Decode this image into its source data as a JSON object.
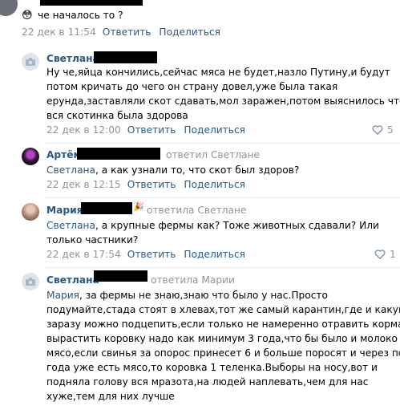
{
  "comment0": {
    "emoji": "😳",
    "text": "че началось то ?",
    "date": "22 дек в 11:54",
    "reply": "Ответить",
    "share": "Поделиться"
  },
  "comments": [
    {
      "author": "Светлана",
      "lines": [
        "Ну че,яйца кончились,сейчас мяса не будет,назло Путину,и будут",
        "потом кричать до чего он страну довел,уже была такая",
        "ерунда,заставляли скот сдавать,мол заражен,потом выяснилось что",
        "вся скотинка была здорова"
      ],
      "date": "22 дек в 12:00",
      "reply": "Ответить",
      "share": "Поделиться",
      "likes": "5"
    },
    {
      "author": "Артём",
      "reply_to": "ответил Светлане",
      "mention": "Светлана",
      "text": ", а как узнали то, что скот был здоров?",
      "date": "22 дек в 12:15",
      "reply": "Ответить",
      "share": "Поделиться"
    },
    {
      "author": "Мария",
      "reply_to": "ответила Светлане",
      "mention": "Светлана",
      "line1": ", а крупные фермы как? Тоже животных сдавали? Или",
      "line2": "только частники?",
      "date": "22 дек в 17:54",
      "reply": "Ответить",
      "share": "Поделиться",
      "likes": "1"
    },
    {
      "author": "Светлана",
      "reply_to": "ответила Марии",
      "mention": "Мария",
      "line1": ", за фермы не знаю,знаю что было у нас.Просто",
      "lines": [
        "подумайте,стада стоят в хлевах,тот же самый карантин,где и какую",
        "заразу можно подцепить,если только не намеренно отравить корма,а",
        "вырастить коровку надо как минимум 3 года,что бы было и молоко и",
        "мясо,если свинья за опорос принесет 6 и больше поросят и через пол",
        "года уже есть мясо,то коровка 1 теленка.Выборы на носу,вот и",
        "подняла голову вся мразота,на людей наплевать,чем для нас",
        "хуже,тем для них лучше"
      ]
    }
  ],
  "colors": {
    "link": "#2a5885",
    "meta": "#939393",
    "like": "#8a9aab"
  }
}
